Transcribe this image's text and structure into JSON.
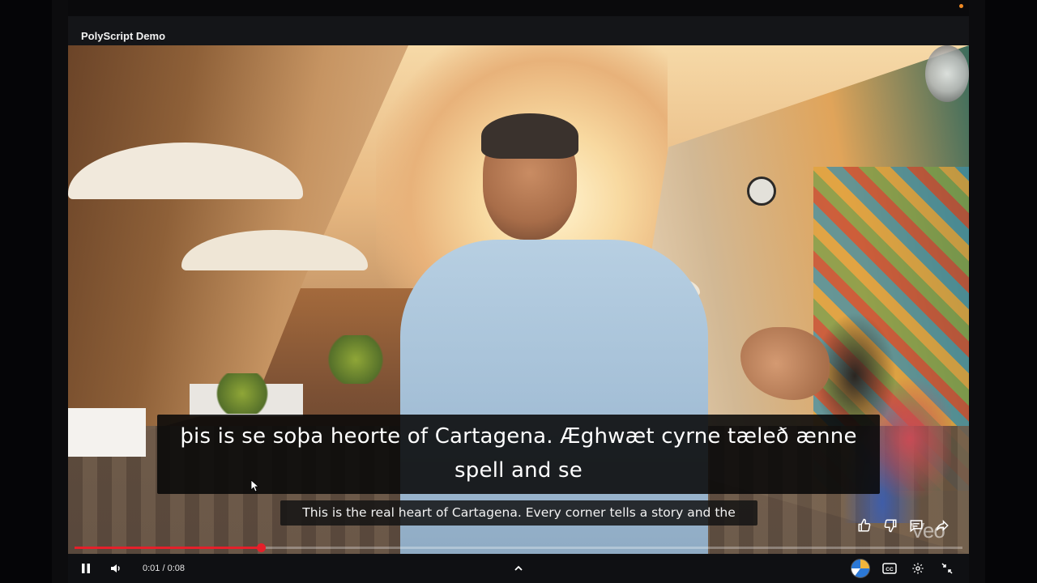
{
  "window": {
    "title": "PolyScript Demo"
  },
  "video": {
    "caption_main": "þis is se soþa heorte of Cartagena. Æghwæt cyrne tæleð ænne spell and se",
    "caption_sub": "This is the real heart of Cartagena. Every corner tells a story and the",
    "watermark": "Veo"
  },
  "player": {
    "time_display": "0:01 / 0:08",
    "current_time": "0:01",
    "duration": "0:08",
    "progress_fraction": 0.21,
    "accent_color": "#e5202a",
    "icons": {
      "play_pause": "pause-icon",
      "volume": "volume-icon",
      "expand": "chevron-up-icon",
      "avatar": "avatar-icon",
      "captions": "cc-icon",
      "settings": "gear-icon",
      "fullscreen": "exit-fullscreen-icon"
    }
  },
  "side_actions": [
    {
      "icon": "thumbs-up-icon"
    },
    {
      "icon": "thumbs-down-icon"
    },
    {
      "icon": "comment-icon"
    },
    {
      "icon": "share-icon"
    }
  ],
  "status": {
    "recording_color": "#f08a24"
  }
}
